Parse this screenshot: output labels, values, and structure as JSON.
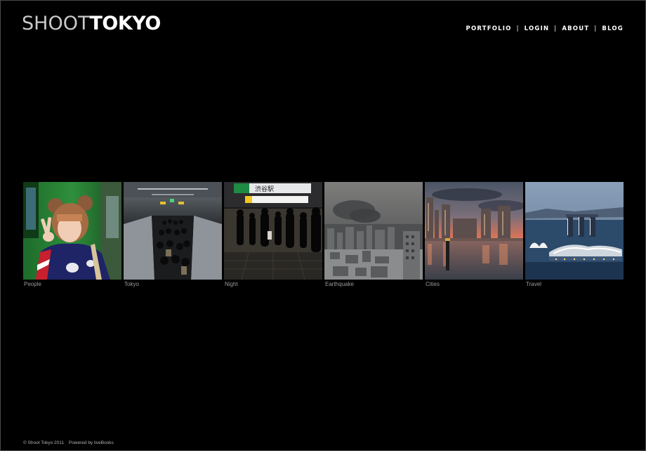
{
  "brand": {
    "logo_light": "SHOOT",
    "logo_bold": "TOKYO"
  },
  "nav": [
    {
      "label": "PORTFOLIO"
    },
    {
      "label": "LOGIN"
    },
    {
      "label": "ABOUT"
    },
    {
      "label": "BLOG"
    }
  ],
  "nav_separator": "|",
  "gallery": [
    {
      "caption": "People"
    },
    {
      "caption": "Tokyo"
    },
    {
      "caption": "Night"
    },
    {
      "caption": "Earthquake"
    },
    {
      "caption": "Cities"
    },
    {
      "caption": "Travel"
    }
  ],
  "sign_text": "渋谷駅",
  "footer": {
    "copyright": "© Shoot Tokyo 2011",
    "powered": "Powered by liveBooks"
  }
}
